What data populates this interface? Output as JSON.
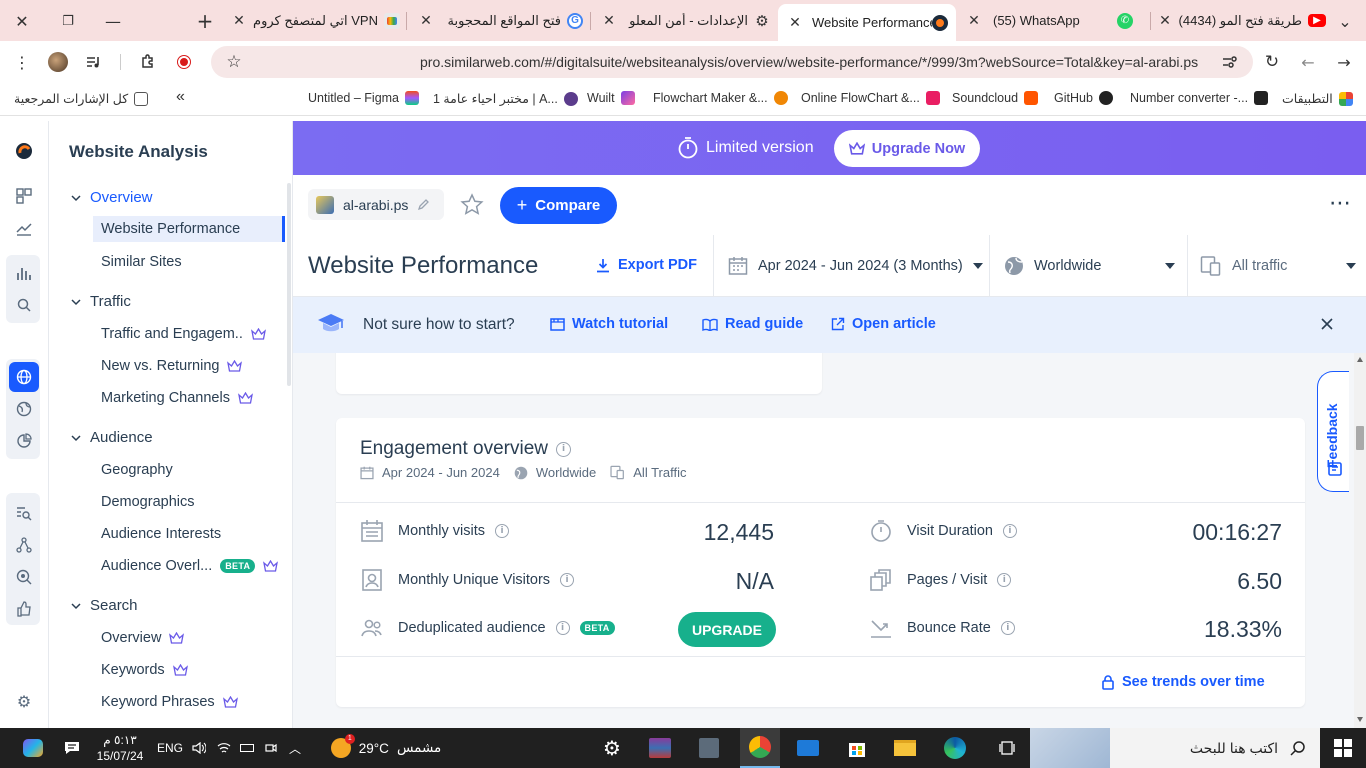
{
  "browser": {
    "tabs": [
      {
        "title": "طريقة فتح المو (4434)",
        "favicon": "youtube-icon"
      },
      {
        "title": "(55) WhatsApp",
        "favicon": "whatsapp-icon"
      },
      {
        "title": "Website Performance",
        "favicon": "similarweb-icon",
        "active": true
      },
      {
        "title": "الإعدادات - أمن المعلو",
        "favicon": "gear-icon"
      },
      {
        "title": "فتح المواقع المحجوبة",
        "favicon": "google-icon"
      },
      {
        "title": "VPN اتي لمتصفح كروم",
        "favicon": "extension-icon"
      }
    ],
    "new_tab_symbol": "+",
    "url": "pro.similarweb.com/#/digitalsuite/websiteanalysis/overview/website-performance/*/999/3m?webSource=Total&key=al-arabi.ps",
    "bookmarks": [
      {
        "label": "التطبيقات",
        "icon": "apps-grid-icon"
      },
      {
        "label": "Number converter -...",
        "icon": "briefcase-icon"
      },
      {
        "label": "GitHub",
        "icon": "github-icon"
      },
      {
        "label": "Soundcloud",
        "icon": "soundcloud-icon"
      },
      {
        "label": "Online FlowChart &...",
        "icon": "heart-icon"
      },
      {
        "label": "Flowchart Maker &...",
        "icon": "drawio-icon"
      },
      {
        "label": "Wuilt",
        "icon": "wuilt-icon"
      },
      {
        "label": "مختبر احياء عامة 1 | A...",
        "icon": "e-icon"
      },
      {
        "label": "Untitled – Figma",
        "icon": "figma-icon"
      }
    ],
    "all_bookmarks_label": "كل الإشارات المرجعية",
    "bookmarks_overflow": "«"
  },
  "banner": {
    "limited_label": "Limited version",
    "upgrade_label": "Upgrade Now"
  },
  "site": {
    "domain": "al-arabi.ps",
    "compare_label": "Compare",
    "more_symbol": "⋯"
  },
  "page": {
    "title": "Website Performance",
    "export_label": "Export PDF",
    "date_range": "Apr 2024 - Jun 2024 (3 Months)",
    "country": "Worldwide",
    "traffic": "All traffic"
  },
  "help": {
    "prompt": "Not sure how to start?",
    "links": [
      "Watch tutorial",
      "Read guide",
      "Open article"
    ]
  },
  "sidebar": {
    "title": "Website Analysis",
    "sections": [
      {
        "label": "Overview",
        "items": [
          "Website Performance",
          "Similar Sites"
        ]
      },
      {
        "label": "Traffic",
        "items": [
          "Traffic and Engagem...",
          "New vs. Returning",
          "Marketing Channels"
        ]
      },
      {
        "label": "Audience",
        "items": [
          "Geography",
          "Demographics",
          "Audience Interests",
          "Audience Overl..."
        ]
      },
      {
        "label": "Search",
        "items": [
          "Overview",
          "Keywords",
          "Keyword Phrases"
        ]
      }
    ],
    "beta_label": "BETA"
  },
  "engagement": {
    "title": "Engagement overview",
    "date": "Apr 2024 - Jun 2024",
    "country": "Worldwide",
    "traffic": "All Traffic",
    "metrics_left": [
      {
        "label": "Monthly visits",
        "value": "12,445"
      },
      {
        "label": "Monthly Unique Visitors",
        "value": "N/A"
      },
      {
        "label": "Deduplicated audience",
        "badge": "BETA",
        "button": "UPGRADE"
      }
    ],
    "metrics_right": [
      {
        "label": "Visit Duration",
        "value": "00:16:27"
      },
      {
        "label": "Pages / Visit",
        "value": "6.50"
      },
      {
        "label": "Bounce Rate",
        "value": "18.33%"
      }
    ],
    "trends_label": "See trends over time"
  },
  "feedback_label": "Feedback",
  "taskbar": {
    "search_placeholder": "اكتب هنا للبحث",
    "weather_temp": "29°C",
    "weather_label": "مشمس",
    "weather_badge": "1",
    "language": "ENG",
    "time": "٥:١٣ م",
    "date": "15/07/24"
  }
}
